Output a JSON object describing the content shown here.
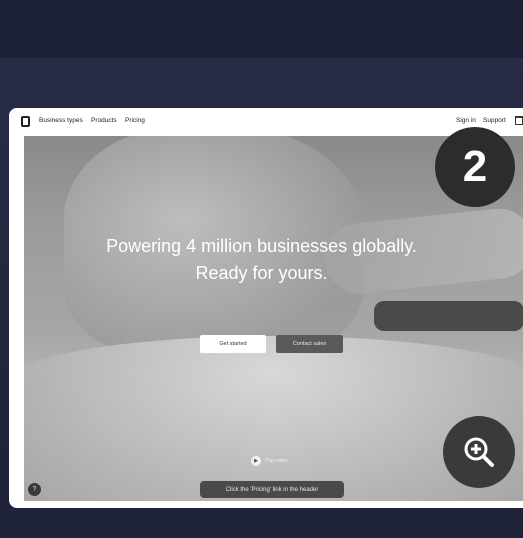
{
  "site_nav": {
    "items": [
      "Business types",
      "Products",
      "Pricing"
    ],
    "right": [
      "Sign in",
      "Support"
    ]
  },
  "hero": {
    "headline_line1": "Powering 4 million businesses globally.",
    "headline_line2": "Ready for yours.",
    "primary_button": "Get started",
    "secondary_button": "Contact sales",
    "play_label": "Play video"
  },
  "overlay": {
    "step_number": "2",
    "instruction": "Click the 'Pricing' link in the header",
    "zoom_icon": "zoom-in-icon"
  },
  "colors": {
    "background": "#1e2238",
    "badge": "#2c2c2c"
  }
}
